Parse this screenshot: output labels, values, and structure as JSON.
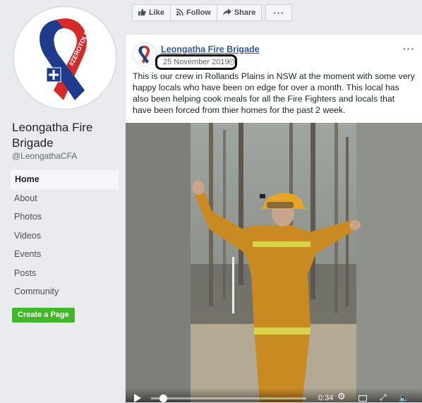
{
  "page": {
    "name": "Leongatha Fire Brigade",
    "handle": "@LeongathaCFA",
    "avatar_text": "#ZEROTOLERANCE"
  },
  "nav": {
    "items": [
      {
        "label": "Home",
        "active": true
      },
      {
        "label": "About"
      },
      {
        "label": "Photos"
      },
      {
        "label": "Videos"
      },
      {
        "label": "Events"
      },
      {
        "label": "Posts"
      },
      {
        "label": "Community"
      }
    ],
    "create_page_label": "Create a Page"
  },
  "actions": {
    "like": {
      "label": "Like",
      "icon": "thumbs-up-icon"
    },
    "follow": {
      "label": "Follow",
      "icon": "rss-icon"
    },
    "share": {
      "label": "Share",
      "icon": "share-arrow-icon"
    },
    "more": {
      "label": "···"
    }
  },
  "post": {
    "author": "Leongatha Fire Brigade",
    "date": "25 November 2019",
    "privacy_icon": "globe-icon",
    "menu": "···",
    "text": "This is our crew in Rollands Plains in NSW at the moment with some very happy locals who have been on edge for over a month. This local has also been helping cook meals for all the Fire Fighters and locals that have been forced from thier homes for the past 2 week.",
    "video": {
      "time": "0:34",
      "progress": 0.08
    }
  },
  "colors": {
    "brand_blue": "#365899",
    "create_green": "#42b72a",
    "ribbon_blue": "#1f3c8c",
    "ribbon_red": "#d42a2a",
    "background": "#e9ebee"
  }
}
